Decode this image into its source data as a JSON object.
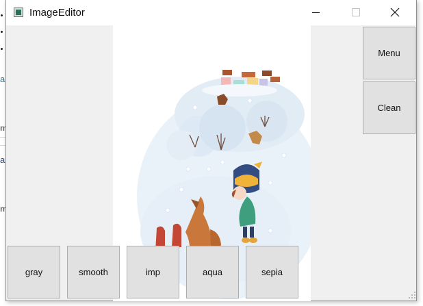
{
  "window": {
    "title": "ImageEditor"
  },
  "side_buttons": {
    "menu": "Menu",
    "clean": "Clean"
  },
  "filters": [
    "gray",
    "smooth",
    "imp",
    "aqua",
    "sepia"
  ],
  "background": {
    "frag1": "a",
    "frag2": "m",
    "frag3": "a",
    "frag4": "m"
  },
  "colors": {
    "window_bg": "#f0f0f0",
    "button_bg": "#e1e1e1",
    "button_border": "#adadad"
  }
}
